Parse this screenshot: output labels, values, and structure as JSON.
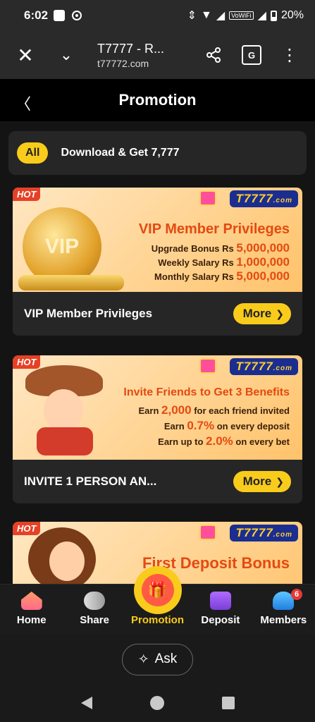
{
  "status_bar": {
    "time": "6:02",
    "battery": "20%",
    "network": "VoWiFi"
  },
  "browser": {
    "title": "T7777 - R...",
    "url": "t77772.com"
  },
  "header": {
    "title": "Promotion"
  },
  "filter": {
    "all_label": "All",
    "text": "Download & Get 7,777"
  },
  "cards": [
    {
      "title": "VIP Member Privileges",
      "more": "More",
      "banner": {
        "hot": "HOT",
        "brand": "T7777",
        "brand_suffix": ".com",
        "coin": "VIP",
        "headline": "VIP Member Privileges",
        "lines": [
          {
            "label": "Upgrade Bonus Rs ",
            "value": "5,000,000"
          },
          {
            "label": "Weekly Salary Rs ",
            "value": "1,000,000"
          },
          {
            "label": "Monthly Salary Rs ",
            "value": "5,000,000"
          }
        ]
      }
    },
    {
      "title": "INVITE 1 PERSON AN...",
      "more": "More",
      "banner": {
        "hot": "HOT",
        "brand": "T7777",
        "brand_suffix": ".com",
        "headline": "Invite Friends to Get 3 Benefits",
        "lines": [
          {
            "pre": "Earn ",
            "value": "2,000",
            "post": " for each friend invited"
          },
          {
            "pre": "Earn ",
            "value": "0.7%",
            "post": " on every deposit"
          },
          {
            "pre": "Earn up to ",
            "value": "2.0%",
            "post": " on every bet"
          }
        ]
      }
    },
    {
      "banner": {
        "hot": "HOT",
        "brand": "T7777",
        "brand_suffix": ".com",
        "headline": "First Deposit Bonus"
      }
    }
  ],
  "bottom_nav": {
    "items": [
      {
        "label": "Home"
      },
      {
        "label": "Share"
      },
      {
        "label": "Promotion"
      },
      {
        "label": "Deposit"
      },
      {
        "label": "Members",
        "badge": "6"
      }
    ]
  },
  "ask": {
    "label": "Ask"
  },
  "colors": {
    "accent": "#f9cc1c",
    "headline": "#e44a12"
  }
}
